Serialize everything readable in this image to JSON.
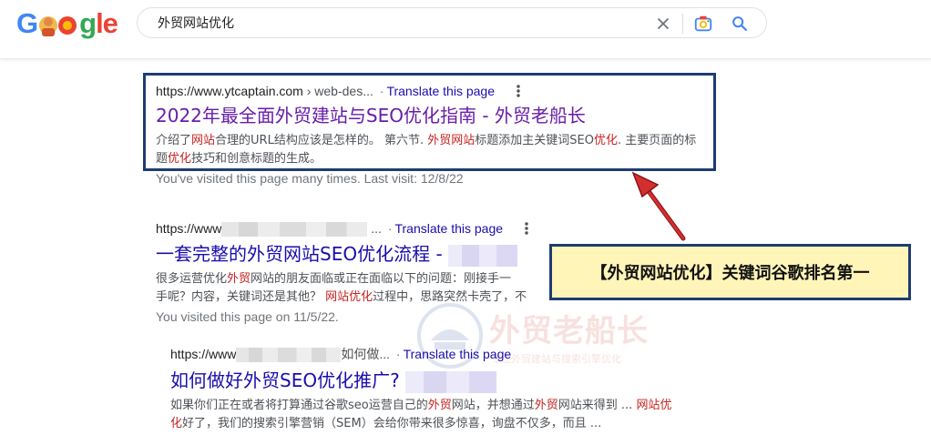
{
  "header": {
    "search_value": "外贸网站优化"
  },
  "results": [
    {
      "url": "https://www.ytcaptain.com",
      "crumb": "› web-des...",
      "translate": "Translate this page",
      "title": "2022年最全面外贸建站与SEO优化指南 - 外贸老船长",
      "snippet_parts": [
        {
          "t": "介绍了",
          "em": false
        },
        {
          "t": "网站",
          "em": true
        },
        {
          "t": "合理的URL结构应该是怎样的。 第六节. ",
          "em": false
        },
        {
          "t": "外贸网站",
          "em": true
        },
        {
          "t": "标题添加主关键词SEO",
          "em": false
        },
        {
          "t": "优化",
          "em": true
        },
        {
          "t": ". 主要页面的标题",
          "em": false
        },
        {
          "t": "优化",
          "em": true
        },
        {
          "t": "技巧和创意标题的生成。",
          "em": false
        }
      ],
      "visit_note": "You've visited this page many times. Last visit: 12/8/22"
    },
    {
      "url": "https://www",
      "crumb": "...",
      "translate": "Translate this page",
      "title": "一套完整的外贸网站SEO优化流程",
      "title_suffix": "-",
      "snippet_line1_parts": [
        {
          "t": "很多运营优化",
          "em": false
        },
        {
          "t": "外贸",
          "em": true
        },
        {
          "t": "网站的朋友面临或正在面临以下的问题：刚接手一",
          "em": false
        }
      ],
      "snippet_line2_parts": [
        {
          "t": "手呢？内容，关键词还是其他？ ",
          "em": false
        },
        {
          "t": "网站优化",
          "em": true
        },
        {
          "t": "过程中，思路突然卡壳了，不",
          "em": false
        }
      ],
      "visit_note": "You visited this page on 11/5/22."
    },
    {
      "url": "https://www",
      "crumb": "如何做...",
      "translate": "Translate this page",
      "title": "如何做好外贸SEO优化推广?",
      "snippet_line1_parts": [
        {
          "t": "如果你们正在或者将打算通过谷歌seo运营自己的",
          "em": false
        },
        {
          "t": "外贸",
          "em": true
        },
        {
          "t": "网站，并想通过",
          "em": false
        },
        {
          "t": "外贸",
          "em": true
        },
        {
          "t": "网站来得到 ... ",
          "em": false
        },
        {
          "t": "网站优",
          "em": true
        }
      ],
      "snippet_line2_parts": [
        {
          "t": "化",
          "em": true
        },
        {
          "t": "好了，我们的搜索引擎营销（SEM）会给你带来很多惊喜，询盘不仅多，而且 ...",
          "em": false
        }
      ]
    }
  ],
  "callout": {
    "text": "【外贸网站优化】关键词谷歌排名第一"
  },
  "watermark": {
    "title": "外贸老船长",
    "subtitle": "专注外贸建站与搜索引擎优化"
  },
  "colors": {
    "link": "#1a0dab",
    "visited": "#681da8",
    "highlight": "#c5221f",
    "annotation_border": "#1e3c72",
    "callout_bg": "#fff5b8",
    "arrow": "#d32f2f"
  }
}
